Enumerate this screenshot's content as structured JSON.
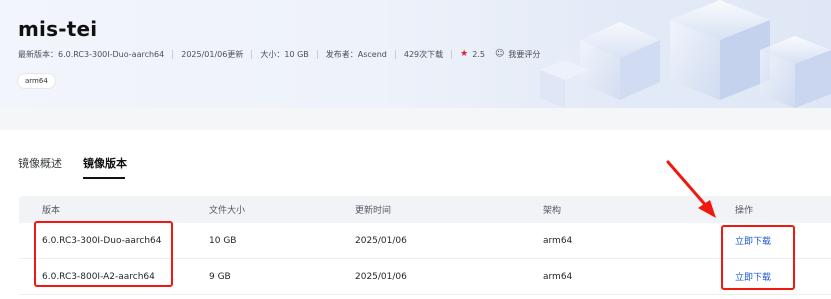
{
  "header": {
    "title": "mis-tei",
    "meta": {
      "latest_version": "最新版本：6.0.RC3-300I-Duo-aarch64",
      "updated": "2025/01/06更新",
      "size": "大小：10 GB",
      "publisher": "发布者：Ascend",
      "downloads": "429次下载",
      "rating": "2.5",
      "rate_action": "我要评分"
    },
    "tag": "arm64"
  },
  "tabs": [
    {
      "label": "镜像概述",
      "active": false
    },
    {
      "label": "镜像版本",
      "active": true
    }
  ],
  "table": {
    "columns": [
      "版本",
      "文件大小",
      "更新时间",
      "架构",
      "操作"
    ],
    "rows": [
      {
        "version": "6.0.RC3-300I-Duo-aarch64",
        "size": "10 GB",
        "updated": "2025/01/06",
        "arch": "arm64",
        "action": "立即下载"
      },
      {
        "version": "6.0.RC3-800I-A2-aarch64",
        "size": "9 GB",
        "updated": "2025/01/06",
        "arch": "arm64",
        "action": "立即下载"
      }
    ]
  },
  "colors": {
    "accent_link": "#1a56d6",
    "annotation_red": "#f0190f",
    "star": "#e0202a"
  }
}
